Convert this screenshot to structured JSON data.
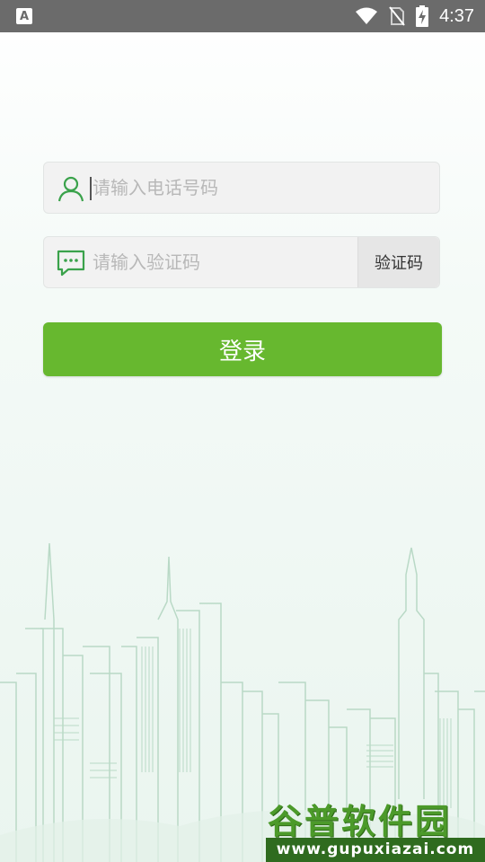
{
  "status_bar": {
    "left_icon_label": "A",
    "time": "4:37",
    "icons": [
      "wifi-icon",
      "no-sim-icon",
      "battery-charging-icon"
    ]
  },
  "form": {
    "phone_placeholder": "请输入电话号码",
    "phone_value": "",
    "phone_icon": "user-icon",
    "code_placeholder": "请输入验证码",
    "code_value": "",
    "code_icon": "sms-bubble-icon",
    "get_code_label": "验证码",
    "login_label": "登录"
  },
  "watermark": {
    "title": "谷普软件园",
    "url": "www.gupuxiazai.com"
  },
  "colors": {
    "accent": "#67b82f",
    "icon": "#3aa24b",
    "status_bar": "#6b6b6b",
    "skyline_line": "#b9d9c6"
  }
}
